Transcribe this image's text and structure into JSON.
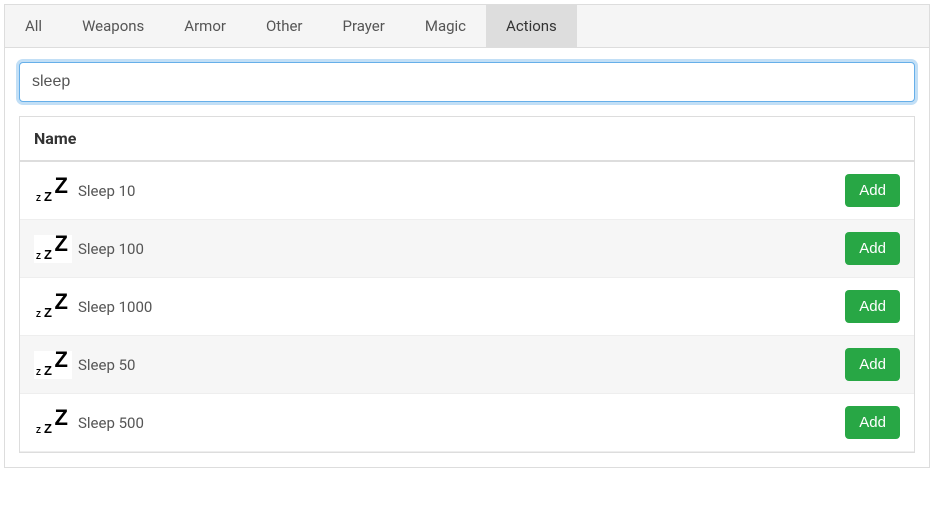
{
  "tabs": [
    {
      "label": "All",
      "active": false
    },
    {
      "label": "Weapons",
      "active": false
    },
    {
      "label": "Armor",
      "active": false
    },
    {
      "label": "Other",
      "active": false
    },
    {
      "label": "Prayer",
      "active": false
    },
    {
      "label": "Magic",
      "active": false
    },
    {
      "label": "Actions",
      "active": true
    }
  ],
  "search": {
    "value": "sleep"
  },
  "table": {
    "header": "Name",
    "add_label": "Add",
    "rows": [
      {
        "icon": "sleep-icon",
        "name": "Sleep 10"
      },
      {
        "icon": "sleep-icon",
        "name": "Sleep 100"
      },
      {
        "icon": "sleep-icon",
        "name": "Sleep 1000"
      },
      {
        "icon": "sleep-icon",
        "name": "Sleep 50"
      },
      {
        "icon": "sleep-icon",
        "name": "Sleep 500"
      }
    ]
  }
}
